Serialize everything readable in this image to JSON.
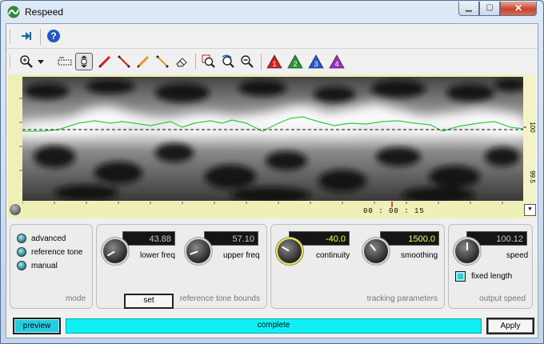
{
  "window": {
    "title": "Respeed"
  },
  "toolbar": {
    "top_buttons": [
      "pin-icon",
      "help-icon"
    ],
    "tools": [
      "zoom-icon",
      "dropdown-arrow-icon",
      "range-select-icon",
      "pan-tool-icon",
      "pencil-red-icon",
      "line-red-icon",
      "pencil-orange-icon",
      "line-orange-icon",
      "eraser-icon",
      "zoom-region-icon",
      "zoom-reset-icon",
      "zoom-out-icon",
      "marker-1-icon",
      "marker-2-icon",
      "marker-3-icon",
      "marker-4-icon"
    ],
    "markers": [
      "1",
      "2",
      "3",
      "4"
    ],
    "marker_colors": [
      "#d12020",
      "#1e9a2c",
      "#2058d8",
      "#a02cc8"
    ]
  },
  "spectrogram": {
    "time_label": "00 : 00 : 15",
    "right_axis_labels": [
      "100",
      "99.5"
    ]
  },
  "mode": {
    "caption": "mode",
    "options": [
      "advanced",
      "reference tone",
      "manual"
    ]
  },
  "reference": {
    "caption": "reference tone bounds",
    "lower_value": "43.88",
    "lower_label": "lower freq",
    "upper_value": "57.10",
    "upper_label": "upper freq",
    "set_label": "set"
  },
  "tracking": {
    "caption": "tracking parameters",
    "continuity_value": "-40.0",
    "continuity_label": "continuity",
    "smoothing_value": "1500.0",
    "smoothing_label": "smoothing"
  },
  "output": {
    "caption": "output speed",
    "speed_value": "100.12",
    "speed_label": "speed",
    "fixed_length_label": "fixed length"
  },
  "bottom": {
    "preview_label": "preview",
    "status": "complete",
    "apply_label": "Apply"
  }
}
